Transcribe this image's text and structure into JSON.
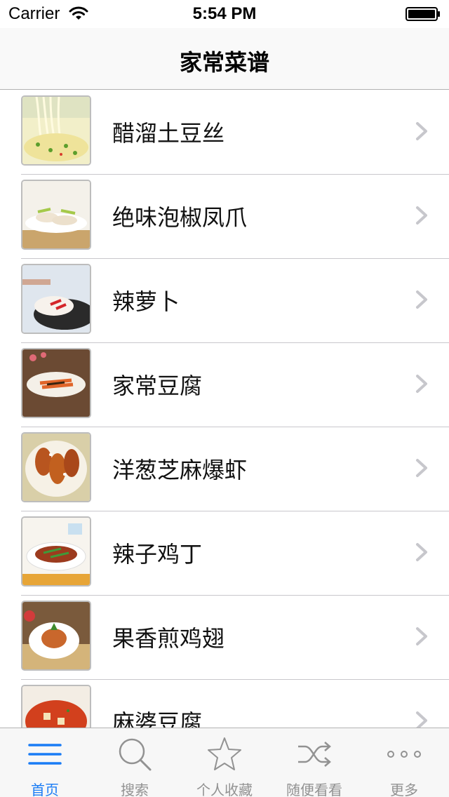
{
  "status_bar": {
    "carrier": "Carrier",
    "time": "5:54 PM"
  },
  "nav": {
    "title": "家常菜谱"
  },
  "recipes": [
    {
      "name": "醋溜土豆丝"
    },
    {
      "name": "绝味泡椒凤爪"
    },
    {
      "name": "辣萝卜"
    },
    {
      "name": "家常豆腐"
    },
    {
      "name": "洋葱芝麻爆虾"
    },
    {
      "name": "辣子鸡丁"
    },
    {
      "name": "果香煎鸡翅"
    },
    {
      "name": "麻婆豆腐"
    }
  ],
  "tabs": [
    {
      "label": "首页",
      "icon": "list-icon",
      "active": true
    },
    {
      "label": "搜索",
      "icon": "search-icon",
      "active": false
    },
    {
      "label": "个人收藏",
      "icon": "star-icon",
      "active": false
    },
    {
      "label": "随便看看",
      "icon": "shuffle-icon",
      "active": false
    },
    {
      "label": "更多",
      "icon": "more-icon",
      "active": false
    }
  ],
  "colors": {
    "accent": "#1a7cf5",
    "inactive_tab": "#929292",
    "separator": "#c8c7cc",
    "chevron": "#c7c7cc"
  }
}
